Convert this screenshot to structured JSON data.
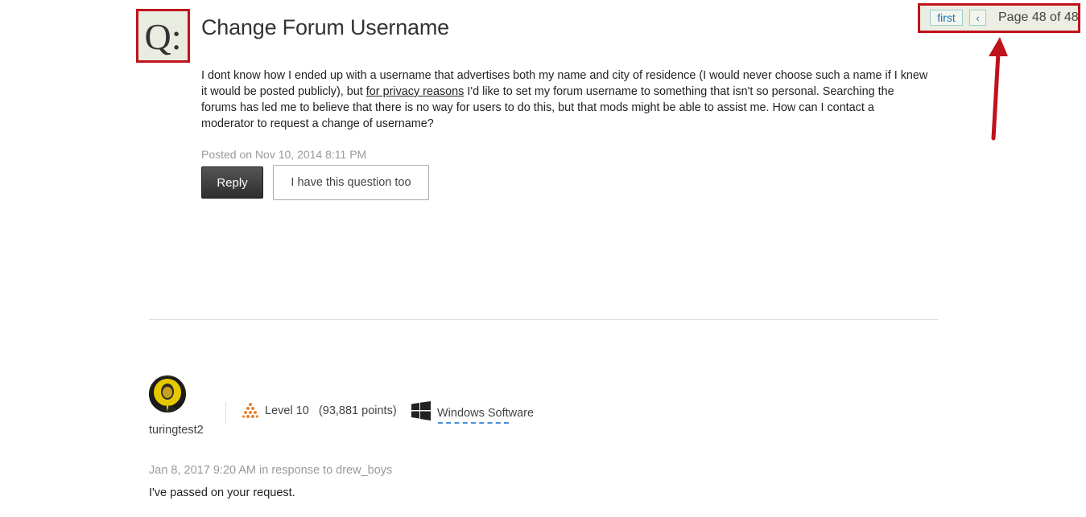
{
  "question": {
    "icon_label": "Q:",
    "title": "Change Forum Username",
    "body_part1": "I dont know how I ended up with a username that advertises both my name and city of residence (I would never choose such a name if I knew it would be posted publicly), but ",
    "body_link": "for privacy reasons",
    "body_part2": " I'd like to set my forum username to something that isn't so personal. Searching the forums has led me to believe that there is no way for users to do this, but that mods might be able to assist me. How can I contact a moderator to request a change of username?",
    "posted": "Posted on Nov 10, 2014 8:11 PM",
    "reply_label": "Reply",
    "have_question_label": "I have this question too"
  },
  "pagination": {
    "first_label": "first",
    "prev_glyph": "‹",
    "page_text": "Page 48 of 48"
  },
  "reply": {
    "username": "turingtest2",
    "level": "Level 10",
    "points": "(93,881 points)",
    "category": "Windows Software",
    "meta": "Jan 8, 2017 9:20 AM in response to drew_boys",
    "body": "I've passed on your request."
  },
  "colors": {
    "highlight": "#c0121b",
    "link_blue": "#1a72b8",
    "level_orange": "#e8822a"
  }
}
